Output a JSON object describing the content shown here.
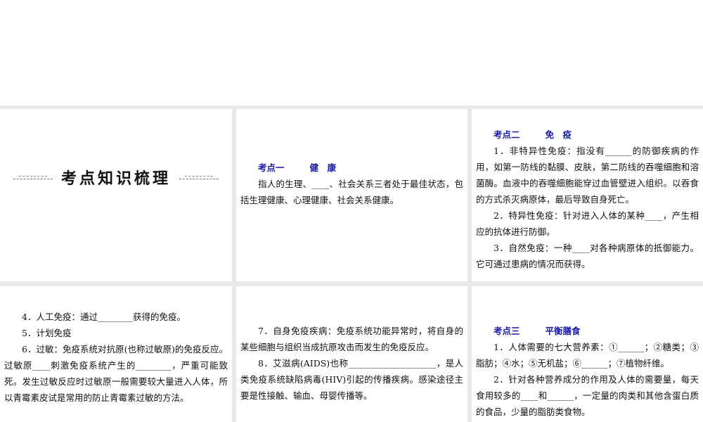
{
  "slides": [
    {
      "title": "考点知识梳理"
    },
    {
      "heading": {
        "label": "考点一",
        "topic": "健　康"
      },
      "paragraphs": [
        "指人的生理、____、社会关系三者处于最佳状态，包括生理健康、心理健康、社会关系健康。"
      ]
    },
    {
      "heading": {
        "label": "考点二",
        "topic": "免　疫"
      },
      "paragraphs": [
        "1．非特异性免疫：指没有______的防御疾病的作用，如第一防线的黏膜、皮肤，第二防线的吞噬细胞和溶菌酶。血液中的吞噬细胞能穿过血管壁进入组织。以吞食的方式杀灭病原体，最后导致自身死亡。",
        "2．特异性免疫：针对进入人体的某种____，产生相应的抗体进行防御。",
        "3．自然免疫：一种____对各种病原体的抵御能力。它可通过患病的情况而获得。"
      ]
    },
    {
      "paragraphs": [
        "4．人工免疫：通过________获得的免疫。",
        "5．计划免疫",
        "6．过敏：免疫系统对抗原(也称过敏原)的免疫反应。过敏原____刺激免疫系统产生的________，严重可能致死。发生过敏反应时过敏原一般需要较大量进入人体，所以青霉素皮试是常用的防止青霉素过敏的方法。"
      ]
    },
    {
      "paragraphs": [
        "7．自身免疫疾病：免疫系统功能异常时，将自身的某些细胞与组织当成抗原攻击而发生的免疫反应。",
        "8．艾滋病(AIDS)也称____________________，是人类免疫系统缺陷病毒(HIV)引起的传播疾病。感染途径主要是性接触、输血、母婴传播等。"
      ]
    },
    {
      "heading": {
        "label": "考点三",
        "topic": "平衡膳食"
      },
      "paragraphs": [
        "1．人体需要的七大营养素：①______；②糖类；③脂肪；④水；⑤无机盐；⑥______；⑦植物纤维。",
        "2．针对各种营养成分的作用及人体的需要量，每天食用较多的____和______，一定量的肉类和其他含蛋白质的食品，少量的脂肪类食物。"
      ]
    }
  ]
}
